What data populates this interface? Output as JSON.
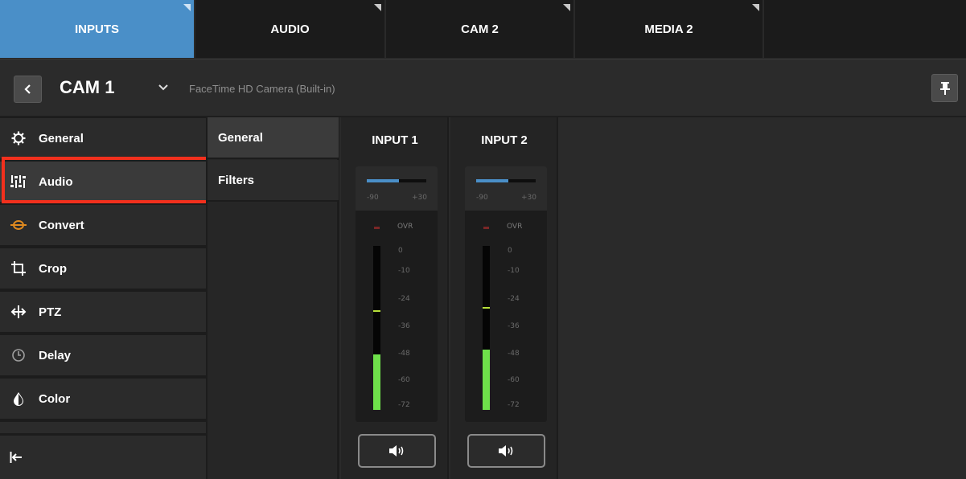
{
  "tabs": [
    {
      "label": "INPUTS",
      "active": true
    },
    {
      "label": "AUDIO",
      "active": false
    },
    {
      "label": "CAM 2",
      "active": false
    },
    {
      "label": "MEDIA 2",
      "active": false
    }
  ],
  "header": {
    "back_icon": "chevron-left-icon",
    "title": "CAM 1",
    "title_dropdown_icon": "chevron-down-icon",
    "subtitle": "FaceTime HD Camera (Built-in)",
    "pin_icon": "pin-icon"
  },
  "sidebar": {
    "items": [
      {
        "label": "General",
        "icon": "gear-icon"
      },
      {
        "label": "Audio",
        "icon": "sliders-icon",
        "selected": true
      },
      {
        "label": "Convert",
        "icon": "convert-icon"
      },
      {
        "label": "Crop",
        "icon": "crop-icon"
      },
      {
        "label": "PTZ",
        "icon": "ptz-icon"
      },
      {
        "label": "Delay",
        "icon": "clock-icon"
      },
      {
        "label": "Color",
        "icon": "color-drop-icon"
      }
    ],
    "collapse_icon": "collapse-left-icon"
  },
  "submenu": {
    "items": [
      {
        "label": "General",
        "active": true
      },
      {
        "label": "Filters",
        "active": false
      }
    ]
  },
  "meters": [
    {
      "title": "INPUT 1",
      "gain_min_label": "-90",
      "gain_max_label": "+30",
      "ovr_label": "OVR",
      "ticks": [
        "0",
        "-10",
        "-24",
        "-36",
        "-48",
        "-60",
        "-72"
      ],
      "level_fraction": 0.34,
      "peak_fraction": 0.6,
      "mute_icon": "speaker-icon"
    },
    {
      "title": "INPUT 2",
      "gain_min_label": "-90",
      "gain_max_label": "+30",
      "ovr_label": "OVR",
      "ticks": [
        "0",
        "-10",
        "-24",
        "-36",
        "-48",
        "-60",
        "-72"
      ],
      "level_fraction": 0.37,
      "peak_fraction": 0.62,
      "mute_icon": "speaker-icon"
    }
  ],
  "colors": {
    "accent": "#4a8fc8",
    "highlight": "#f2301d",
    "meter_green": "#6ee04a",
    "convert_orange": "#e08a1f"
  }
}
